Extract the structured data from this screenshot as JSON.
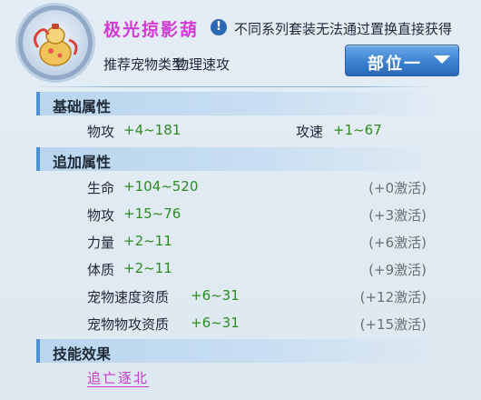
{
  "header": {
    "title": "极光掠影葫",
    "info_text": "不同系列套装无法通过置换直接获得",
    "pet_type_label": "推荐宠物类型:",
    "pet_type_value": "物理速攻",
    "slot_button": "部位一"
  },
  "sections": {
    "base": {
      "title": "基础属性",
      "items": [
        {
          "label": "物攻",
          "value": "+4~181"
        },
        {
          "label": "攻速",
          "value": "+1~67"
        }
      ]
    },
    "extra": {
      "title": "追加属性",
      "rows": [
        {
          "label": "生命",
          "value": "+104~520",
          "activation": "(+0激活)"
        },
        {
          "label": "物攻",
          "value": "+15~76",
          "activation": "(+3激活)"
        },
        {
          "label": "力量",
          "value": "+2~11",
          "activation": "(+6激活)"
        },
        {
          "label": "体质",
          "value": "+2~11",
          "activation": "(+9激活)"
        },
        {
          "label": "宠物速度资质",
          "value": "+6~31",
          "activation": "(+12激活)"
        },
        {
          "label": "宠物物攻资质",
          "value": "+6~31",
          "activation": "(+15激活)"
        }
      ]
    },
    "skill": {
      "title": "技能效果",
      "link": "追亡逐北"
    }
  },
  "colors": {
    "title": "#d23ad8",
    "value_green": "#2e8b20",
    "skill_link": "#c63ccf",
    "button_blue": "#3d82d2"
  }
}
